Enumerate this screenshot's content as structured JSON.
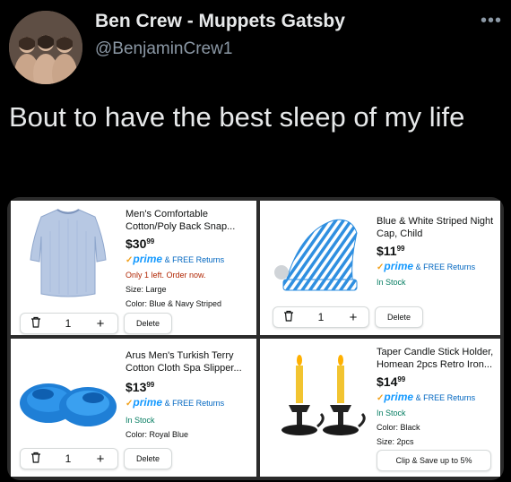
{
  "tweet": {
    "author_name": "Ben Crew - Muppets Gatsby",
    "author_handle": "@BenjaminCrew1",
    "text": "Bout to have the best sleep of my life",
    "more_icon": "more-horizontal-icon"
  },
  "cart": {
    "items": [
      {
        "title": "Men's Comfortable Cotton/Poly Back Snap...",
        "price_whole": "$30",
        "price_fraction": "99",
        "prime_label": "prime",
        "returns": "& FREE Returns",
        "stock": "Only 1 left. Order now.",
        "size": "Size: Large",
        "color": "Color: Blue & Navy Striped",
        "quantity": "1",
        "delete_label": "Delete",
        "image_icon": "hospital-gown-icon"
      },
      {
        "title": "Blue & White Striped Night Cap, Child",
        "price_whole": "$11",
        "price_fraction": "99",
        "prime_label": "prime",
        "returns": "& FREE Returns",
        "stock": "In Stock",
        "quantity": "1",
        "delete_label": "Delete",
        "image_icon": "night-cap-icon"
      },
      {
        "title": "Arus Men's Turkish Terry Cotton Cloth Spa Slipper...",
        "price_whole": "$13",
        "price_fraction": "99",
        "prime_label": "prime",
        "returns": "& FREE Returns",
        "stock": "In Stock",
        "color": "Color: Royal Blue",
        "quantity": "1",
        "delete_label": "Delete",
        "image_icon": "slippers-icon"
      },
      {
        "title": "Taper Candle Stick Holder, Homean 2pcs Retro Iron...",
        "price_whole": "$14",
        "price_fraction": "99",
        "prime_label": "prime",
        "returns": "& FREE Returns",
        "stock": "In Stock",
        "color": "Color: Black",
        "size": "Size: 2pcs",
        "clip_label": "Clip & Save up to 5%",
        "image_icon": "candle-holder-icon"
      }
    ],
    "stepper": {
      "trash_icon": "trash-icon",
      "plus_symbol": "+",
      "plus_icon": "plus-icon"
    }
  },
  "colors": {
    "background": "#000000",
    "name_text": "#e7e9ea",
    "handle_text": "#8b98a5",
    "price_text": "#0f1111",
    "prime_blue": "#1399ff",
    "stock_red": "#b12704",
    "stock_green": "#067d62"
  }
}
